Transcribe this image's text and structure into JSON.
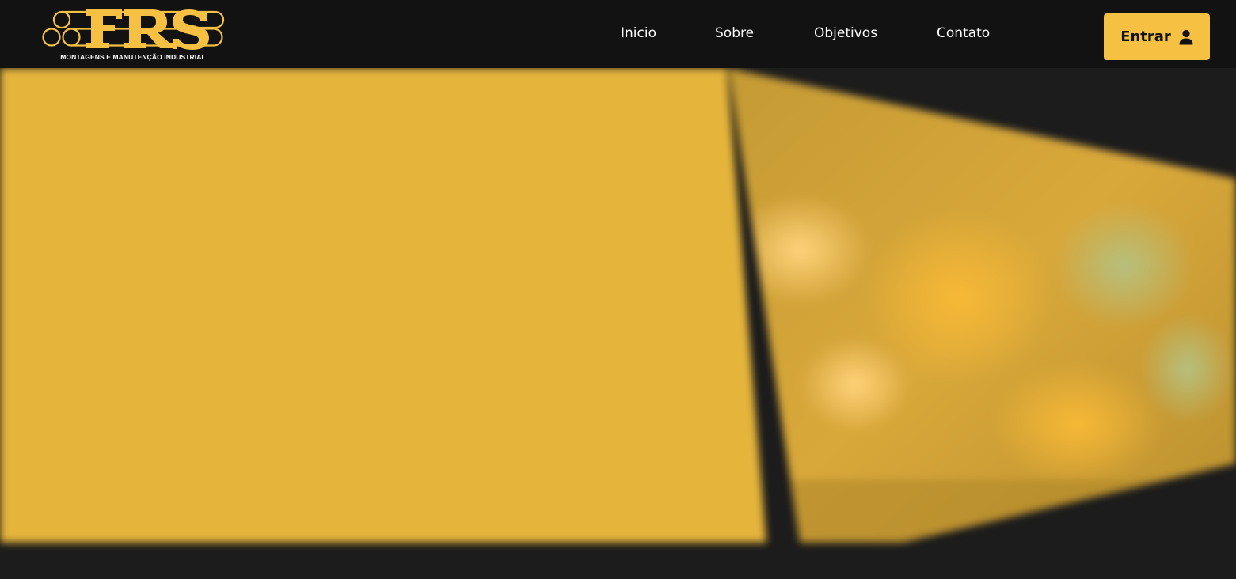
{
  "brand": {
    "logo_text": "FRS",
    "tagline": "MONTAGENS E MANUTENÇÃO INDUSTRIAL",
    "logo_icon": "pipes-logo-icon",
    "color": "#f6c043"
  },
  "nav": {
    "items": [
      {
        "label": "Inicio"
      },
      {
        "label": "Sobre"
      },
      {
        "label": "Objetivos"
      },
      {
        "label": "Contato"
      }
    ]
  },
  "login_button": {
    "label": "Entrar",
    "icon": "user-icon"
  },
  "colors": {
    "navbar": "#121212",
    "background": "#1c1c1c",
    "accent": "#f6c043",
    "hero_panel": "#e5b43b"
  },
  "hero": {
    "image": "blurred-industrial-welding-photo"
  }
}
